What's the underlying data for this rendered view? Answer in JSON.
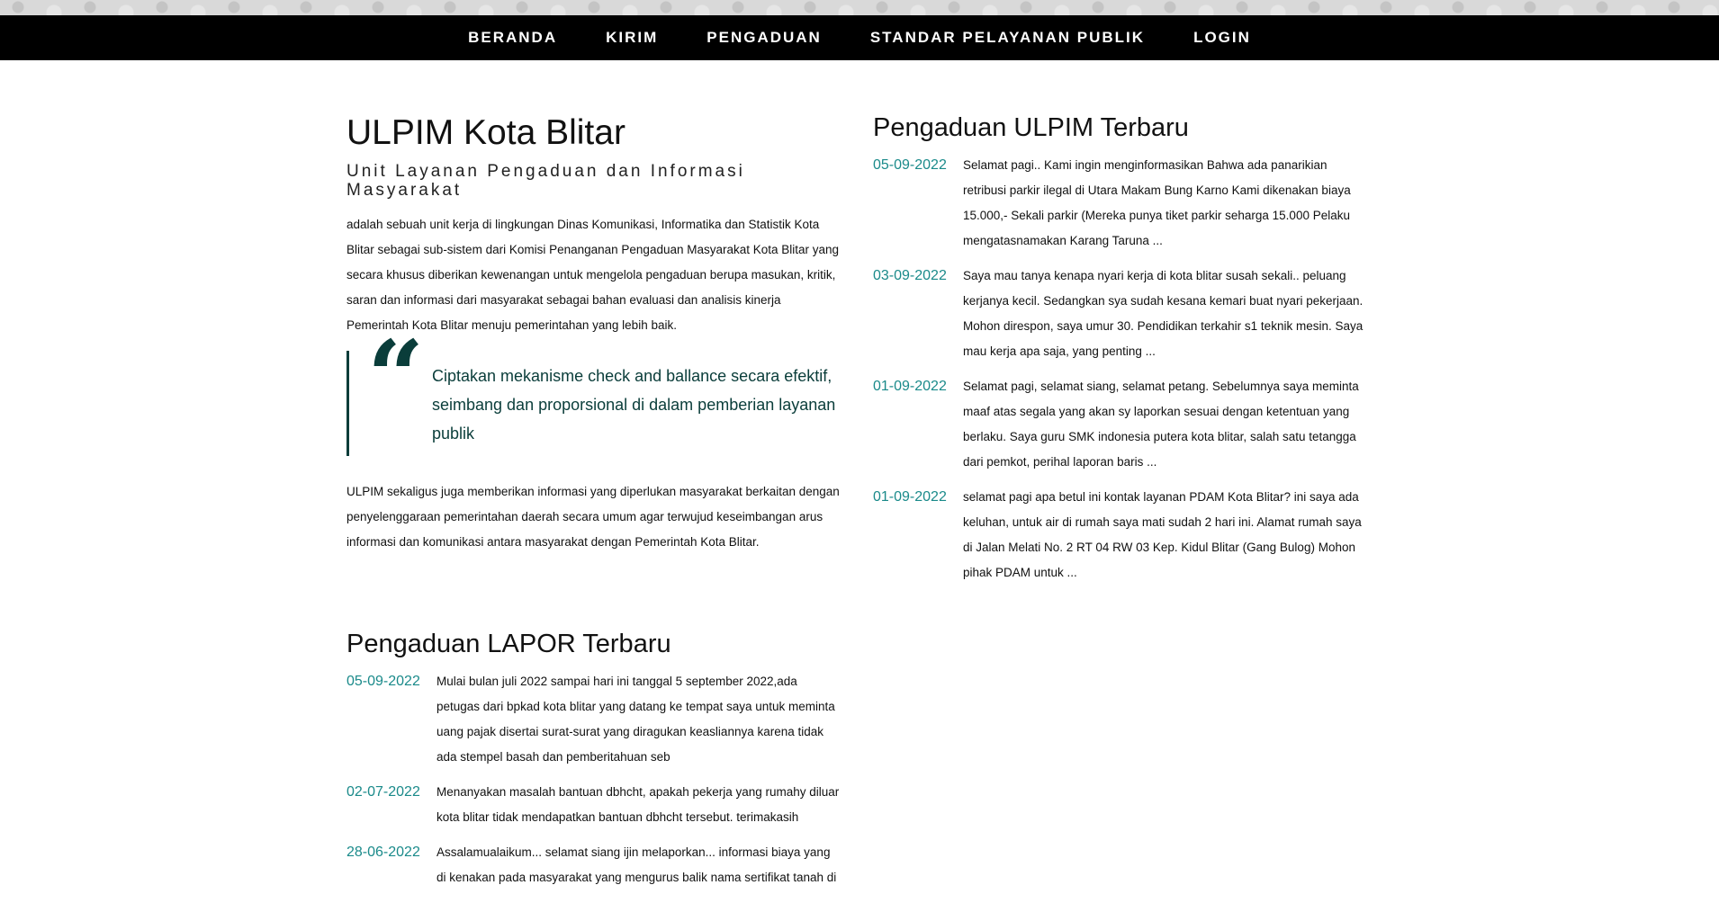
{
  "nav": {
    "items": [
      "BERANDA",
      "KIRIM",
      "PENGADUAN",
      "STANDAR PELAYANAN PUBLIK",
      "LOGIN"
    ]
  },
  "intro": {
    "title": "ULPIM Kota Blitar",
    "subtitle": "Unit Layanan Pengaduan dan Informasi Masyarakat",
    "description": "adalah sebuah unit kerja di lingkungan Dinas Komunikasi, Informatika dan Statistik Kota Blitar sebagai sub-sistem dari Komisi Penanganan Pengaduan Masyarakat Kota Blitar yang secara khusus diberikan kewenangan untuk mengelola pengaduan berupa masukan, kritik, saran dan informasi dari masyarakat sebagai bahan evaluasi dan analisis kinerja Pemerintah Kota Blitar menuju pemerintahan yang lebih baik.",
    "quote": "Ciptakan mekanisme check and ballance secara efektif, seimbang dan proporsional di dalam pemberian layanan publik",
    "closing": "ULPIM sekaligus juga memberikan informasi yang diperlukan masyarakat berkaitan dengan penyelenggaraan pemerintahan daerah secara umum agar terwujud keseimbangan arus informasi dan komunikasi antara masyarakat dengan Pemerintah Kota Blitar."
  },
  "lapor": {
    "title": "Pengaduan LAPOR Terbaru",
    "entries": [
      {
        "date": "05-09-2022",
        "text": "Mulai bulan juli 2022 sampai hari ini tanggal 5 september 2022,ada petugas dari bpkad kota blitar yang datang ke tempat saya untuk meminta uang pajak disertai surat-surat yang diragukan keasliannya karena tidak ada stempel basah dan pemberitahuan seb"
      },
      {
        "date": "02-07-2022",
        "text": "Menanyakan masalah bantuan dbhcht, apakah pekerja yang rumahy diluar kota blitar tidak mendapatkan bantuan dbhcht tersebut. terimakasih"
      },
      {
        "date": "28-06-2022",
        "text": "Assalamualaikum... selamat siang ijin melaporkan... informasi biaya yang di kenakan pada masyarakat yang mengurus balik nama sertifikat tanah di"
      }
    ]
  },
  "ulpim": {
    "title": "Pengaduan ULPIM Terbaru",
    "entries": [
      {
        "date": "05-09-2022",
        "text": "Selamat pagi.. Kami ingin menginformasikan Bahwa ada panarikian retribusi parkir ilegal di Utara Makam Bung Karno Kami dikenakan biaya 15.000,- Sekali parkir (Mereka punya tiket parkir seharga 15.000 Pelaku mengatasnamakan Karang Taruna ..."
      },
      {
        "date": "03-09-2022",
        "text": "Saya mau tanya kenapa nyari kerja di kota blitar susah sekali.. peluang kerjanya kecil. Sedangkan sya sudah kesana kemari buat nyari pekerjaan. Mohon direspon, saya umur 30. Pendidikan terkahir s1 teknik mesin. Saya mau kerja apa saja, yang penting ..."
      },
      {
        "date": "01-09-2022",
        "text": "Selamat pagi, selamat siang, selamat petang. Sebelumnya saya meminta maaf atas segala yang akan sy laporkan sesuai dengan ketentuan yang berlaku. Saya guru SMK indonesia putera kota blitar, salah satu tetangga dari pemkot, perihal laporan baris ..."
      },
      {
        "date": "01-09-2022",
        "text": "selamat pagi apa betul ini kontak layanan PDAM Kota Blitar? ini saya ada keluhan, untuk air di rumah saya mati sudah 2 hari ini. Alamat rumah saya di Jalan Melati No. 2 RT 04 RW 03 Kep. Kidul Blitar (Gang Bulog) Mohon pihak PDAM untuk ..."
      }
    ]
  },
  "colors": {
    "accent": "#1a8a8a",
    "quote": "#0a3d3a",
    "nav_bg": "#000000"
  }
}
